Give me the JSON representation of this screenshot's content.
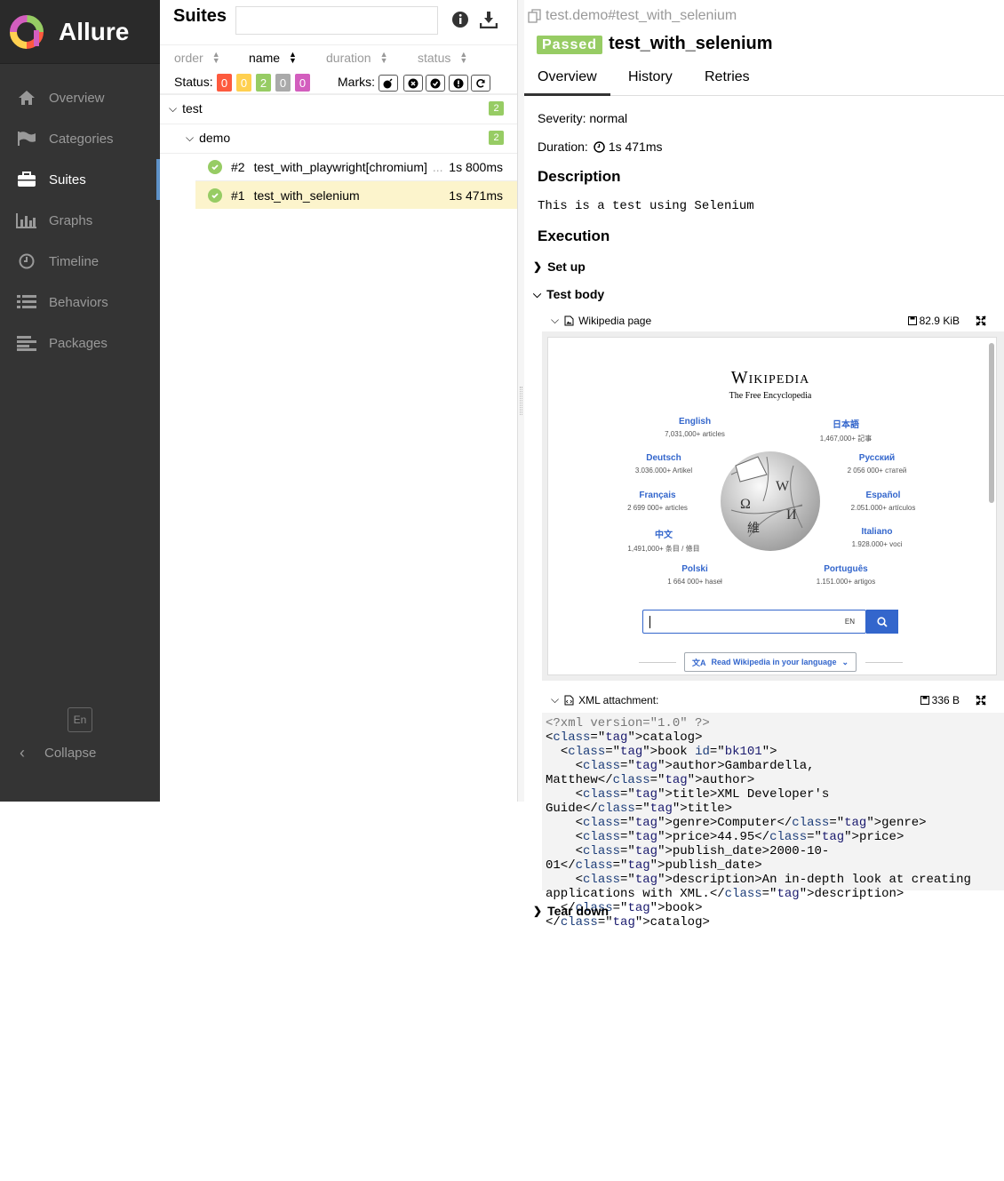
{
  "app": {
    "name": "Allure"
  },
  "sidebar": {
    "items": [
      {
        "label": "Overview",
        "icon": "home-icon",
        "active": false
      },
      {
        "label": "Categories",
        "icon": "flag-icon",
        "active": false
      },
      {
        "label": "Suites",
        "icon": "briefcase-icon",
        "active": true
      },
      {
        "label": "Graphs",
        "icon": "bar-chart-icon",
        "active": false
      },
      {
        "label": "Timeline",
        "icon": "clock-icon",
        "active": false
      },
      {
        "label": "Behaviors",
        "icon": "list-icon",
        "active": false
      },
      {
        "label": "Packages",
        "icon": "align-left-icon",
        "active": false
      }
    ],
    "lang": "En",
    "collapse": "Collapse"
  },
  "suites": {
    "title": "Suites",
    "search_placeholder": "",
    "sort": {
      "order": "order",
      "name": "name",
      "duration": "duration",
      "status": "status"
    },
    "status_label": "Status:",
    "status_counts": [
      "0",
      "0",
      "2",
      "0",
      "0"
    ],
    "marks_label": "Marks:",
    "tree": {
      "suite": {
        "name": "test",
        "count": "2"
      },
      "subsuite": {
        "name": "demo",
        "count": "2"
      },
      "tests": [
        {
          "order": "#2",
          "name": "test_with_playwright[chromium]",
          "ellipsis": "...",
          "duration": "1s 800ms"
        },
        {
          "order": "#1",
          "name": "test_with_selenium",
          "duration": "1s 471ms"
        }
      ]
    }
  },
  "detail": {
    "path": "test.demo#test_with_selenium",
    "status": "Passed",
    "name": "test_with_selenium",
    "tabs": [
      "Overview",
      "History",
      "Retries"
    ],
    "severity": "Severity: normal",
    "duration_label": "Duration:",
    "duration": "1s 471ms",
    "description_title": "Description",
    "description": "This is a test using Selenium",
    "execution_title": "Execution",
    "setup": "Set up",
    "test_body": "Test body",
    "attachment1": {
      "name": "Wikipedia page",
      "size": "82.9 KiB"
    },
    "attachment2": {
      "name": "XML attachment:",
      "size": "336 B"
    },
    "teardown": "Tear down"
  },
  "wikipedia": {
    "title": "Wikipedia",
    "tagline": "The Free Encyclopedia",
    "languages": [
      {
        "name": "English",
        "count": "7,031,000+ articles"
      },
      {
        "name": "日本語",
        "count": "1,467,000+ 記事"
      },
      {
        "name": "Deutsch",
        "count": "3.036.000+ Artikel"
      },
      {
        "name": "Русский",
        "count": "2 056 000+ статей"
      },
      {
        "name": "Français",
        "count": "2 699 000+ articles"
      },
      {
        "name": "Español",
        "count": "2.051.000+ artículos"
      },
      {
        "name": "中文",
        "count": "1,491,000+ 条目 / 條目"
      },
      {
        "name": "Italiano",
        "count": "1.928.000+ voci"
      },
      {
        "name": "Polski",
        "count": "1 664 000+ haseł"
      },
      {
        "name": "Português",
        "count": "1.151.000+ artigos"
      }
    ],
    "search_lang": "EN",
    "read_button": "Read Wikipedia in your language"
  },
  "xml_lines": [
    "<?xml version=\"1.0\" ?>",
    "<catalog>",
    "  <book id=\"bk101\">",
    "    <author>Gambardella, Matthew</author>",
    "    <title>XML Developer's Guide</title>",
    "    <genre>Computer</genre>",
    "    <price>44.95</price>",
    "    <publish_date>2000-10-01</publish_date>",
    "    <description>An in-depth look at creating applications with XML.</description>",
    "  </book>",
    "</catalog>"
  ],
  "colors": {
    "passed": "#97cc64",
    "failed": "#fd5a3e",
    "broken": "#ffd050",
    "skipped": "#aaaaaa",
    "unknown": "#d35ebe",
    "accent": "#5e92c8"
  }
}
